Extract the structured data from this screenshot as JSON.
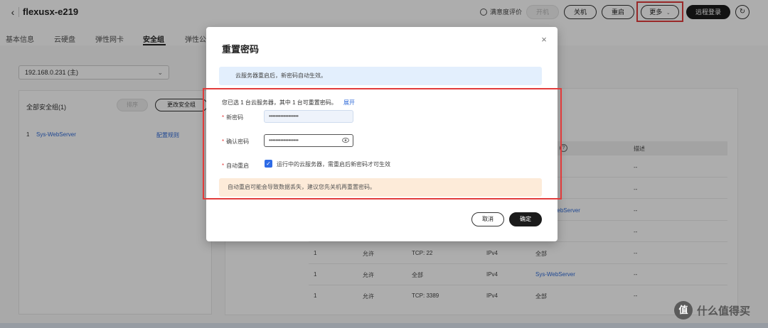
{
  "header": {
    "back_icon": "chevron-left-icon",
    "title": "flexusx-e219",
    "rating_label": "满意度评价",
    "buttons": {
      "power_on": "开机",
      "power_off": "关机",
      "restart": "重启",
      "more": "更多",
      "remote_login": "远程登录"
    },
    "refresh_icon": "refresh-icon"
  },
  "tabs": [
    "基本信息",
    "云硬盘",
    "弹性网卡",
    "安全组",
    "弹性公"
  ],
  "active_tab": "安全组",
  "left_panel": {
    "ip_select": "192.168.0.231 (主)",
    "group_title": "全部安全组(1)",
    "sort_button": "排序",
    "change_button": "更改安全组",
    "rows": [
      {
        "index": "1",
        "name": "Sys-WebServer",
        "action": "配置规则"
      }
    ]
  },
  "right_table": {
    "header_desc": "描述",
    "rows": [
      {
        "priority": "",
        "action": "",
        "port": "",
        "type": "",
        "source": "",
        "desc": "--"
      },
      {
        "priority": "",
        "action": "",
        "port": "",
        "type": "",
        "source": "",
        "desc": "--"
      },
      {
        "priority": "",
        "action": "",
        "port": "",
        "type": "",
        "source": "WebServer",
        "desc": "--"
      },
      {
        "priority": "",
        "action": "",
        "port": "",
        "type": "",
        "source": "",
        "desc": "--"
      },
      {
        "priority": "1",
        "action": "允许",
        "port": "TCP: 22",
        "type": "IPv4",
        "source": "全部",
        "desc": "--"
      },
      {
        "priority": "1",
        "action": "允许",
        "port": "全部",
        "type": "IPv4",
        "source": "Sys-WebServer",
        "desc": "--"
      },
      {
        "priority": "1",
        "action": "允许",
        "port": "TCP: 3389",
        "type": "IPv4",
        "source": "全部",
        "desc": "--"
      }
    ]
  },
  "dialog": {
    "title": "重置密码",
    "close_icon": "close-icon",
    "info": "云服务器重启后，新密码自动生效。",
    "description": "您已选 1 台云服务器，其中 1 台可重置密码。",
    "expand": "展开",
    "new_password_label": "新密码",
    "new_password_value": "••••••••••••••••••",
    "confirm_password_label": "确认密码",
    "confirm_password_value": "••••••••••••••••••",
    "auto_restart_label": "自动重启",
    "auto_restart_checked": true,
    "auto_restart_text": "运行中的云服务器，需重启后新密码才可生效",
    "warning": "自动重启可能会导致数据丢失，建议您先关机再重置密码。",
    "cancel": "取消",
    "confirm": "确定"
  },
  "colors": {
    "highlight_red": "#e23b3b",
    "link_blue": "#2f6ad8",
    "info_bg": "#e3effd",
    "warn_bg": "#fdebd9",
    "primary_dark": "#1b1b1b"
  },
  "watermark": {
    "text": "什么值得买",
    "logo_char": "值"
  }
}
